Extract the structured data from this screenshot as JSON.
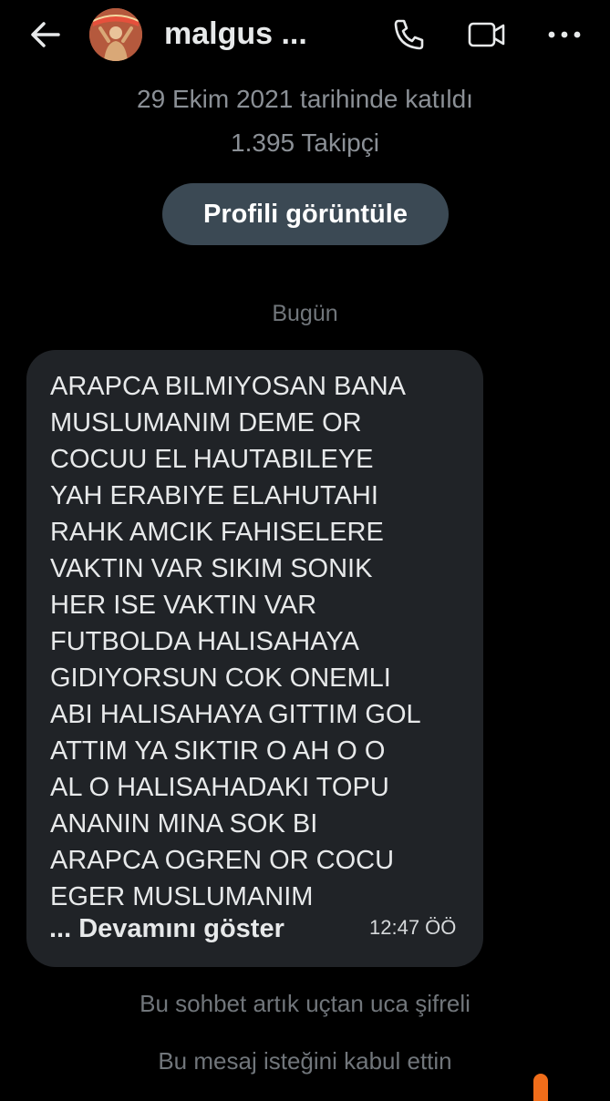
{
  "header": {
    "username": "malgus ...",
    "icons": {
      "back": "arrow-left-icon",
      "call": "phone-icon",
      "video": "video-camera-icon",
      "more": "more-horizontal-icon"
    }
  },
  "profile": {
    "joined": "29 Ekim 2021 tarihinde katıldı",
    "followers": "1.395 Takipçi",
    "view_profile_label": "Profili görüntüle"
  },
  "conversation": {
    "date_separator": "Bugün",
    "message": {
      "text": "ARAPCA BILMIYOSAN BANA\nMUSLUMANIM DEME OR\nCOCUU EL HAUTABILEYE\nYAH ERABIYE ELAHUTAHI\nRAHK AMCIK FAHISELERE\nVAKTIN VAR SIKIM SONIK\nHER ISE VAKTIN VAR\nFUTBOLDA HALISAHAYA\nGIDIYORSUN COK ONEMLI\nABI HALISAHAYA GITTIM GOL\nATTIM YA SIKTIR O AH O O\nAL O HALISAHADAKI TOPU\nANANIN MINA SOK BI\nARAPCA OGREN OR COCU\nEGER MUSLUMANIM",
      "show_more_label": "... Devamını göster",
      "time": "12:47 ÖÖ"
    },
    "encrypted_notice": "Bu sohbet artık uçtan uca şifreli",
    "accepted_notice": "Bu mesaj isteğini kabul ettin"
  },
  "colors": {
    "background": "#000000",
    "bubble": "#202327",
    "button": "#3b4954",
    "muted_text": "#71767b",
    "accent_orange": "#f06d1a"
  }
}
